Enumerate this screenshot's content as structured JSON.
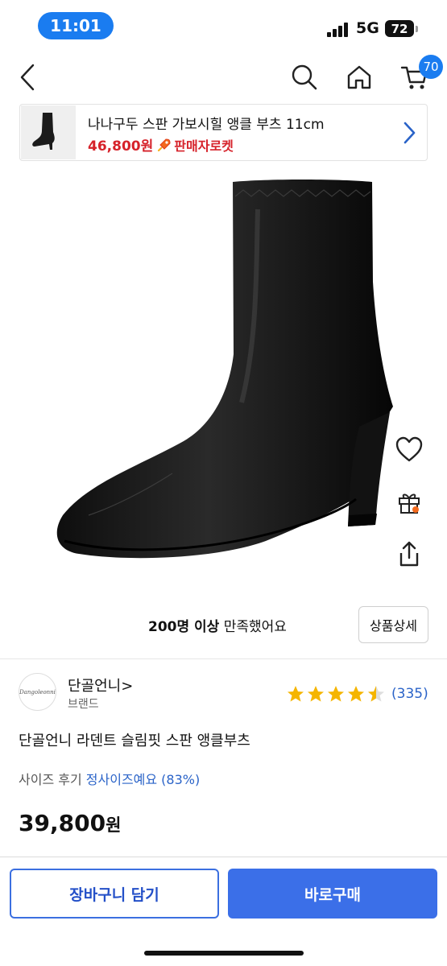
{
  "status_bar": {
    "time": "11:01",
    "network": "5G",
    "battery": "72"
  },
  "nav": {
    "cart_count": "70",
    "icons": [
      "back-icon",
      "search-icon",
      "home-icon",
      "cart-icon"
    ]
  },
  "summary": {
    "title": "나나구두 스판 가보시힐 앵클 부츠 11cm",
    "price": "46,800원",
    "rocket_label": "판매자로켓"
  },
  "product": {
    "satisfaction_count": "200명 이상",
    "satisfaction_text": " 만족했어요",
    "detail_button": "상품상세",
    "brand_name": "단골언니>",
    "brand_logo_text": "Dangoleonni",
    "brand_sub": "브랜드",
    "rating": 4.5,
    "review_count": "(335)",
    "name": "단골언니 라덴트 슬림핏 스판 앵클부츠",
    "size_review_label": "사이즈 후기",
    "size_review_value": "정사이즈예요 (83%)",
    "price_number": "39,800",
    "price_unit": "원"
  },
  "actions": {
    "cart_label": "장바구니 담기",
    "buy_label": "바로구매"
  },
  "colors": {
    "accent_blue": "#3b6fe8",
    "price_red": "#d6222a",
    "star_gold": "#f5b500",
    "link_blue": "#2a63c8"
  }
}
